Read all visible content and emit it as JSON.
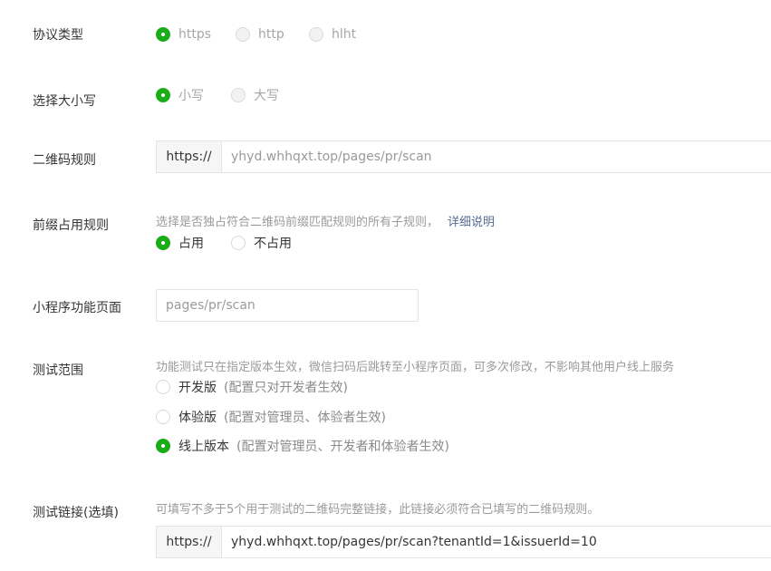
{
  "protocol": {
    "label": "协议类型",
    "options": [
      "https",
      "http",
      "hlht"
    ]
  },
  "case": {
    "label": "选择大小写",
    "options": [
      "小写",
      "大写"
    ]
  },
  "qr_rule": {
    "label": "二维码规则",
    "prefix": "https://",
    "placeholder": "yhyd.whhqxt.top/pages/pr/scan"
  },
  "prefix_occupy": {
    "label": "前缀占用规则",
    "hint": "选择是否独占符合二维码前缀匹配规则的所有子规则，",
    "hint_link": "详细说明",
    "options": [
      "占用",
      "不占用"
    ]
  },
  "mini_page": {
    "label": "小程序功能页面",
    "placeholder": "pages/pr/scan"
  },
  "test_scope": {
    "label": "测试范围",
    "hint": "功能测试只在指定版本生效，微信扫码后跳转至小程序页面，可多次修改，不影响其他用户线上服务",
    "options": [
      {
        "label": "开发版",
        "note": "(配置只对开发者生效)"
      },
      {
        "label": "体验版",
        "note": "(配置对管理员、体验者生效)"
      },
      {
        "label": "线上版本",
        "note": "(配置对管理员、开发者和体验者生效)"
      }
    ]
  },
  "test_link": {
    "label": "测试链接(选填)",
    "hint": "可填写不多于5个用于测试的二维码完整链接，此链接必须符合已填写的二维码规则。",
    "prefix": "https://",
    "value": "yhyd.whhqxt.top/pages/pr/scan?tenantId=1&issuerId=10"
  },
  "colors": {
    "accent": "#1aad19",
    "link": "#576b95",
    "hint": "#9a9a9a"
  }
}
